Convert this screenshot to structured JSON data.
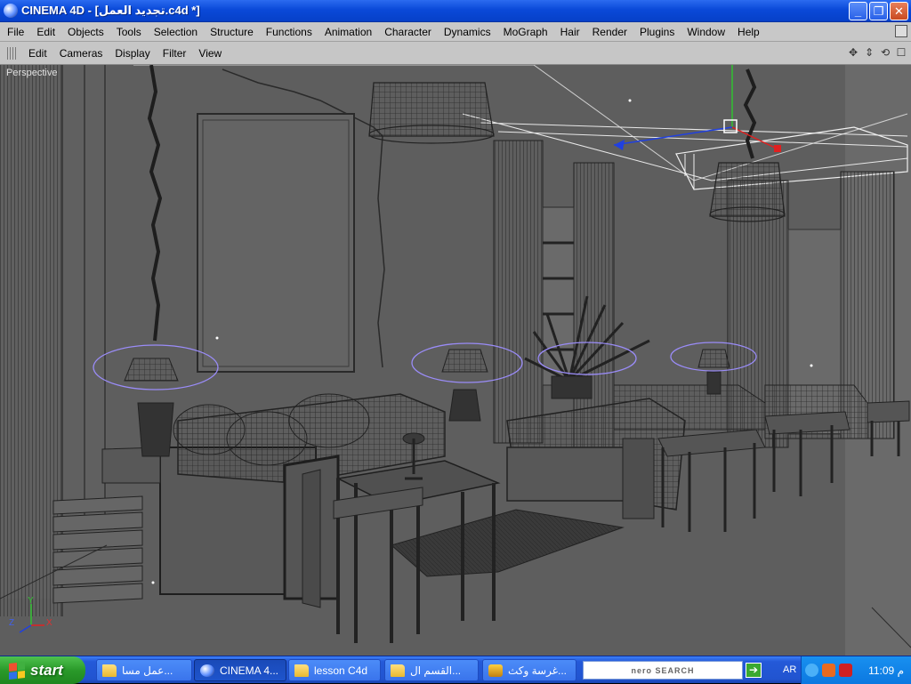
{
  "window": {
    "title": "CINEMA 4D - [تجديد العمل.c4d *]",
    "minimize": "_",
    "maximize": "❐",
    "close": "✕"
  },
  "menubar": {
    "items": [
      "File",
      "Edit",
      "Objects",
      "Tools",
      "Selection",
      "Structure",
      "Functions",
      "Animation",
      "Character",
      "Dynamics",
      "MoGraph",
      "Hair",
      "Render",
      "Plugins",
      "Window",
      "Help"
    ]
  },
  "viewport_menu": {
    "items": [
      "Edit",
      "Cameras",
      "Display",
      "Filter",
      "View"
    ]
  },
  "viewport": {
    "label": "Perspective",
    "axis_y": "Y",
    "axis_z": "Z",
    "axis_x": "X"
  },
  "taskbar": {
    "start_label": "start",
    "tasks": [
      {
        "label": "عمل مسا...",
        "icon": "folder-icon"
      },
      {
        "label": "CINEMA 4...",
        "icon": "cinema4d-icon"
      },
      {
        "label": "lesson C4d",
        "icon": "folder-icon"
      },
      {
        "label": "القسم ال...",
        "icon": "folder-icon"
      },
      {
        "label": "غرسة وكث...",
        "icon": "app-icon"
      }
    ],
    "search_logo": "nero SEARCH",
    "go_symbol": "➔",
    "language": "AR",
    "clock": "11:09 م"
  },
  "colors": {
    "title_blue": "#0a49d8",
    "menu_gray": "#c8c8c8",
    "viewport_gray": "#5c5c5c",
    "wire_dark": "#222222",
    "wire_light": "#d8d8d8",
    "selection_violet": "#9a8cf8",
    "axis_green": "#30c030",
    "axis_red": "#e02020",
    "axis_blue": "#2040e0"
  }
}
